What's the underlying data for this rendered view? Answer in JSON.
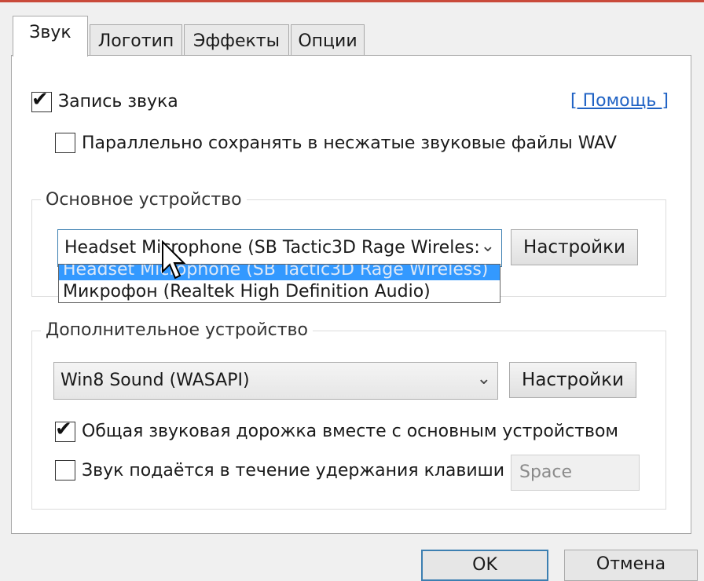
{
  "tabs": [
    {
      "label": "Звук",
      "active": true
    },
    {
      "label": "Логотип",
      "active": false
    },
    {
      "label": "Эффекты",
      "active": false
    },
    {
      "label": "Опции",
      "active": false
    }
  ],
  "record_sound": {
    "label": "Запись звука",
    "checked": true
  },
  "help_link": "[ Помощь ]",
  "save_wav": {
    "label": "Параллельно сохранять в несжатые звуковые файлы WAV",
    "checked": false
  },
  "primary_device": {
    "group_title": "Основное устройство",
    "selected": "Headset Microphone (SB Tactic3D Rage Wireles:",
    "settings_label": "Настройки",
    "options": [
      "Headset Microphone (SB Tactic3D Rage Wireless)",
      "Микрофон (Realtek High Definition Audio)"
    ]
  },
  "secondary_device": {
    "group_title": "Дополнительное устройство",
    "selected": "Win8 Sound (WASAPI)",
    "settings_label": "Настройки",
    "shared_track": {
      "label": "Общая звуковая дорожка вместе с основным устройством",
      "checked": true
    },
    "push_to_talk": {
      "label": "Звук подаётся в течение удержания клавиши",
      "checked": false
    },
    "hotkey": "Space"
  },
  "footer": {
    "ok_label": "OK",
    "cancel_label": "Отмена"
  },
  "colors": {
    "accent": "#3399ff",
    "link": "#1f62c4"
  }
}
